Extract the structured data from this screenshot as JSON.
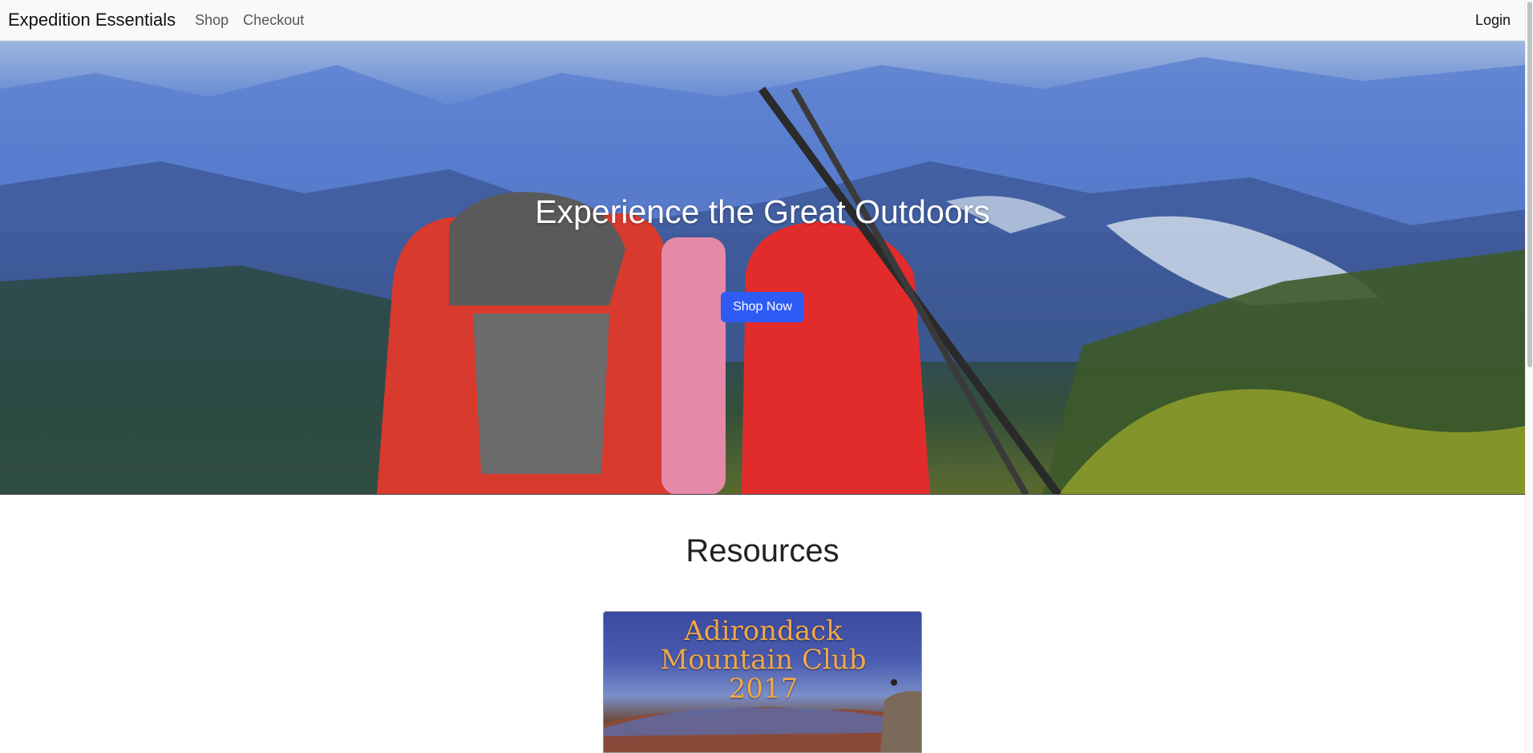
{
  "navbar": {
    "brand": "Expedition Essentials",
    "links": [
      "Shop",
      "Checkout"
    ],
    "login": "Login"
  },
  "hero": {
    "title": "Experience the Great Outdoors",
    "button_label": "Shop Now",
    "button_color": "#2f5bf5"
  },
  "resources": {
    "heading": "Resources",
    "card": {
      "title_lines": [
        "Adirondack",
        "Mountain Club",
        "2017"
      ]
    }
  }
}
